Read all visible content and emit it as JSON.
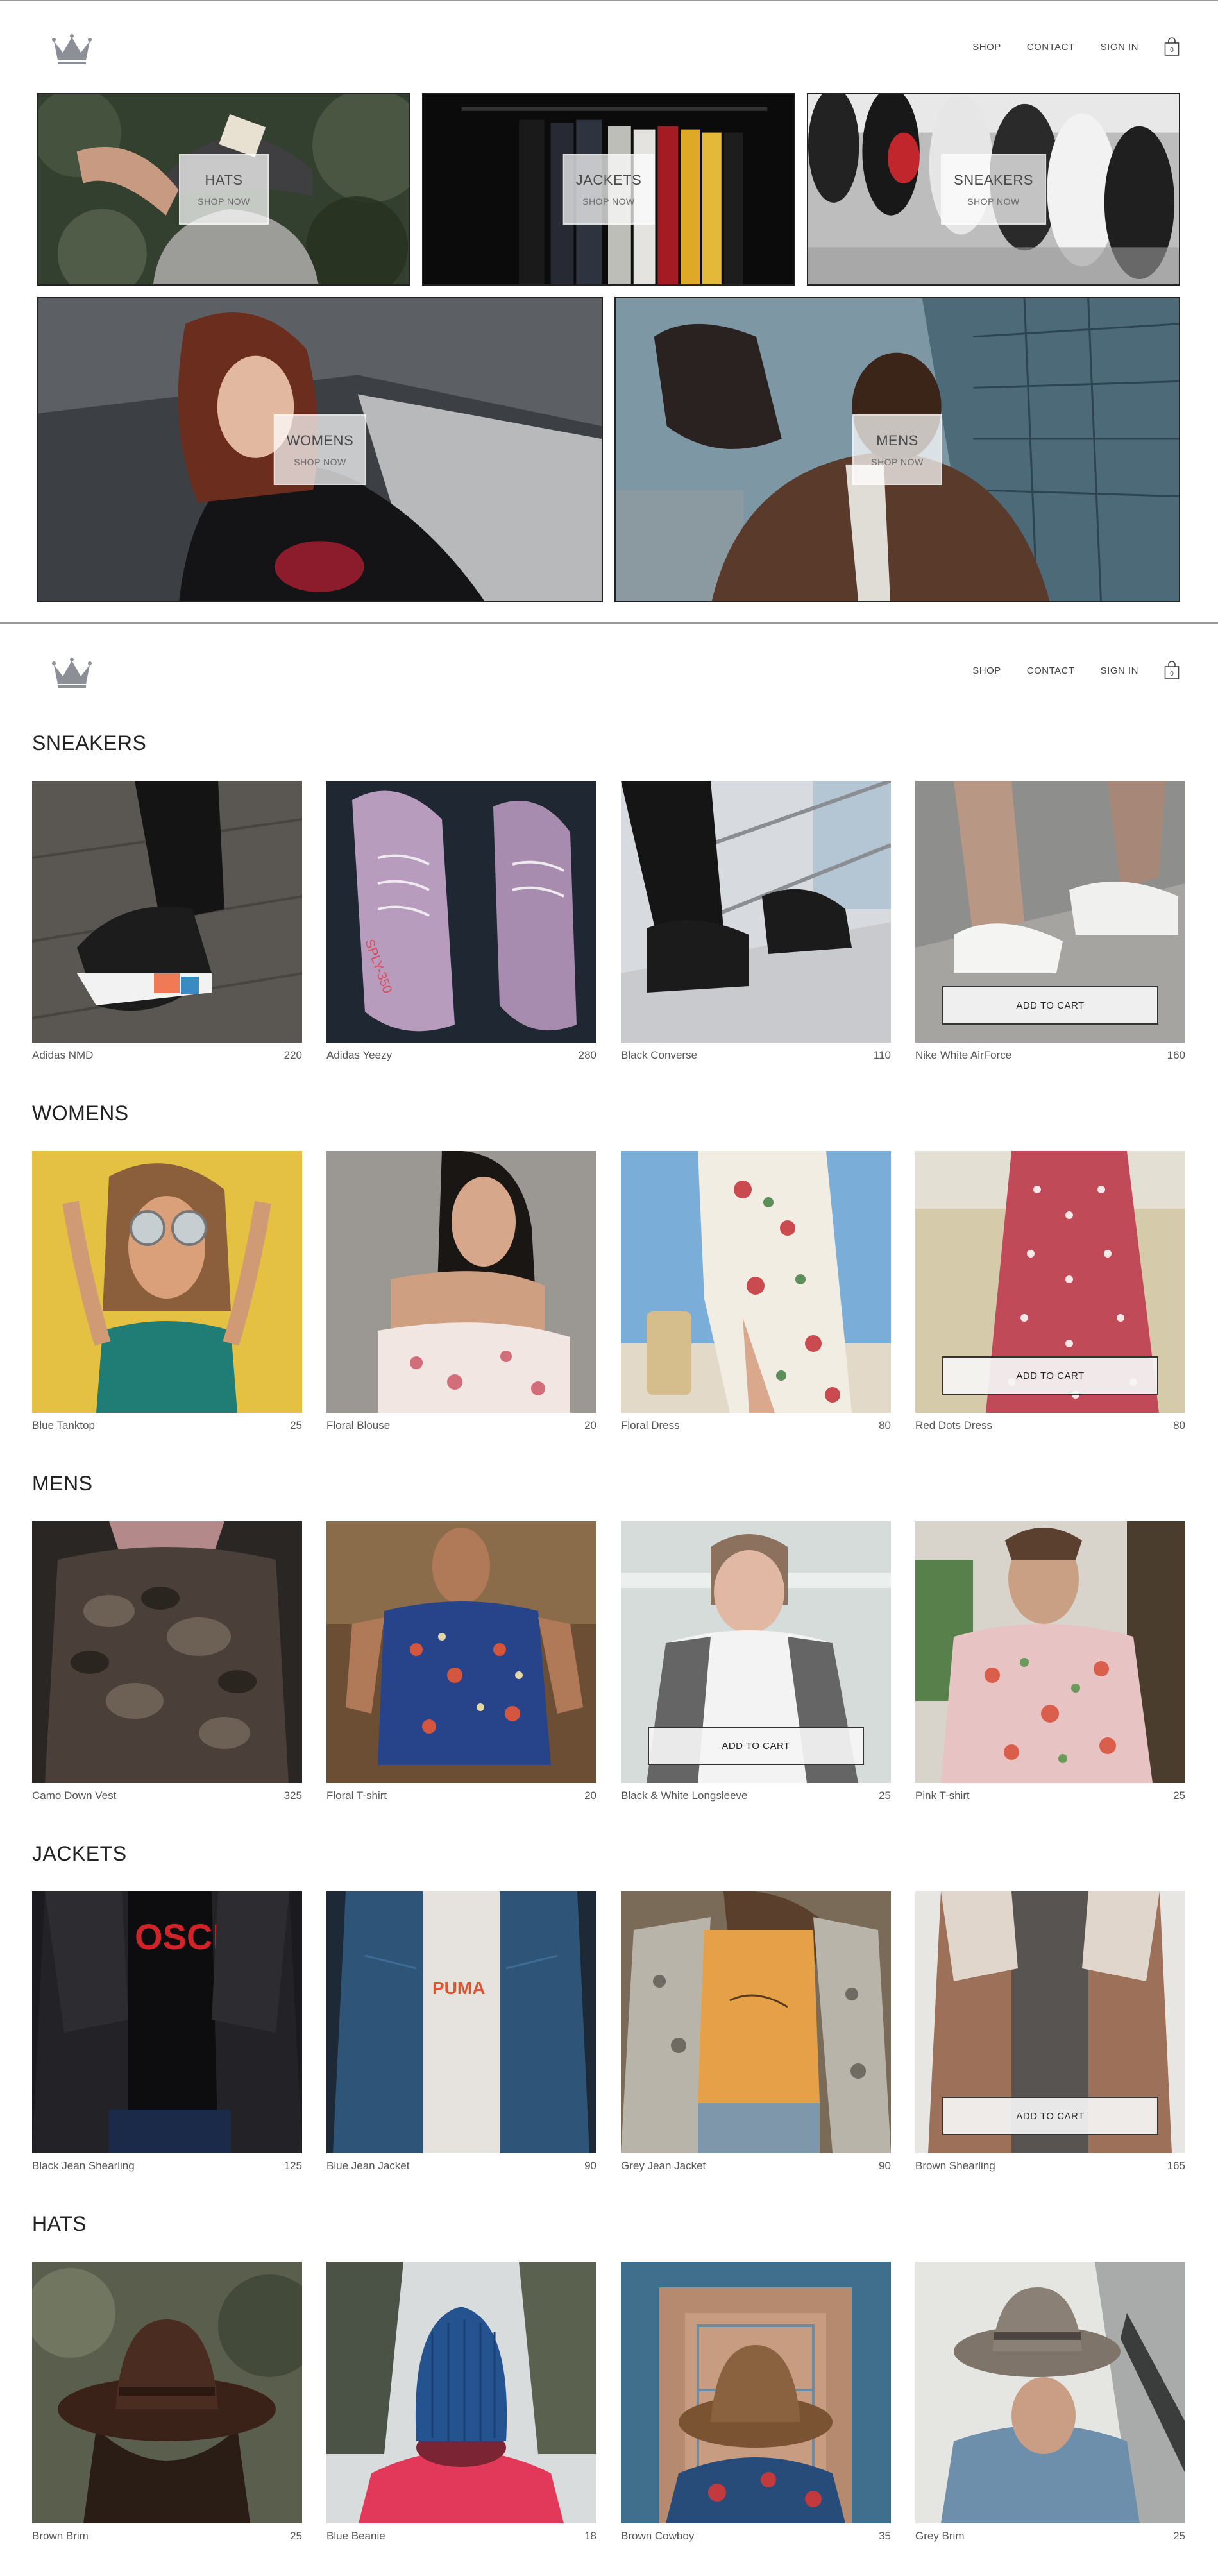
{
  "header": {
    "logo_icon": "crown-logo-icon",
    "nav": {
      "shop": "SHOP",
      "contact": "CONTACT",
      "sign_in": "SIGN IN"
    },
    "cart_icon": "shopping-bag-icon",
    "cart_count": "0"
  },
  "directory": [
    {
      "title": "HATS",
      "subtitle": "SHOP NOW"
    },
    {
      "title": "JACKETS",
      "subtitle": "SHOP NOW"
    },
    {
      "title": "SNEAKERS",
      "subtitle": "SHOP NOW"
    },
    {
      "title": "WOMENS",
      "subtitle": "SHOP NOW"
    },
    {
      "title": "MENS",
      "subtitle": "SHOP NOW"
    }
  ],
  "add_to_cart_label": "ADD TO CART",
  "collections": [
    {
      "title": "SNEAKERS",
      "items": [
        {
          "name": "Adidas NMD",
          "price": "220"
        },
        {
          "name": "Adidas Yeezy",
          "price": "280"
        },
        {
          "name": "Black Converse",
          "price": "110"
        },
        {
          "name": "Nike White AirForce",
          "price": "160"
        }
      ]
    },
    {
      "title": "WOMENS",
      "items": [
        {
          "name": "Blue Tanktop",
          "price": "25"
        },
        {
          "name": "Floral Blouse",
          "price": "20"
        },
        {
          "name": "Floral Dress",
          "price": "80"
        },
        {
          "name": "Red Dots Dress",
          "price": "80"
        }
      ]
    },
    {
      "title": "MENS",
      "items": [
        {
          "name": "Camo Down Vest",
          "price": "325"
        },
        {
          "name": "Floral T-shirt",
          "price": "20"
        },
        {
          "name": "Black & White Longsleeve",
          "price": "25"
        },
        {
          "name": "Pink T-shirt",
          "price": "25"
        }
      ]
    },
    {
      "title": "JACKETS",
      "items": [
        {
          "name": "Black Jean Shearling",
          "price": "125"
        },
        {
          "name": "Blue Jean Jacket",
          "price": "90"
        },
        {
          "name": "Grey Jean Jacket",
          "price": "90"
        },
        {
          "name": "Brown Shearling",
          "price": "165"
        }
      ]
    },
    {
      "title": "HATS",
      "items": [
        {
          "name": "Brown Brim",
          "price": "25"
        },
        {
          "name": "Blue Beanie",
          "price": "18"
        },
        {
          "name": "Brown Cowboy",
          "price": "35"
        },
        {
          "name": "Grey Brim",
          "price": "25"
        }
      ]
    }
  ]
}
